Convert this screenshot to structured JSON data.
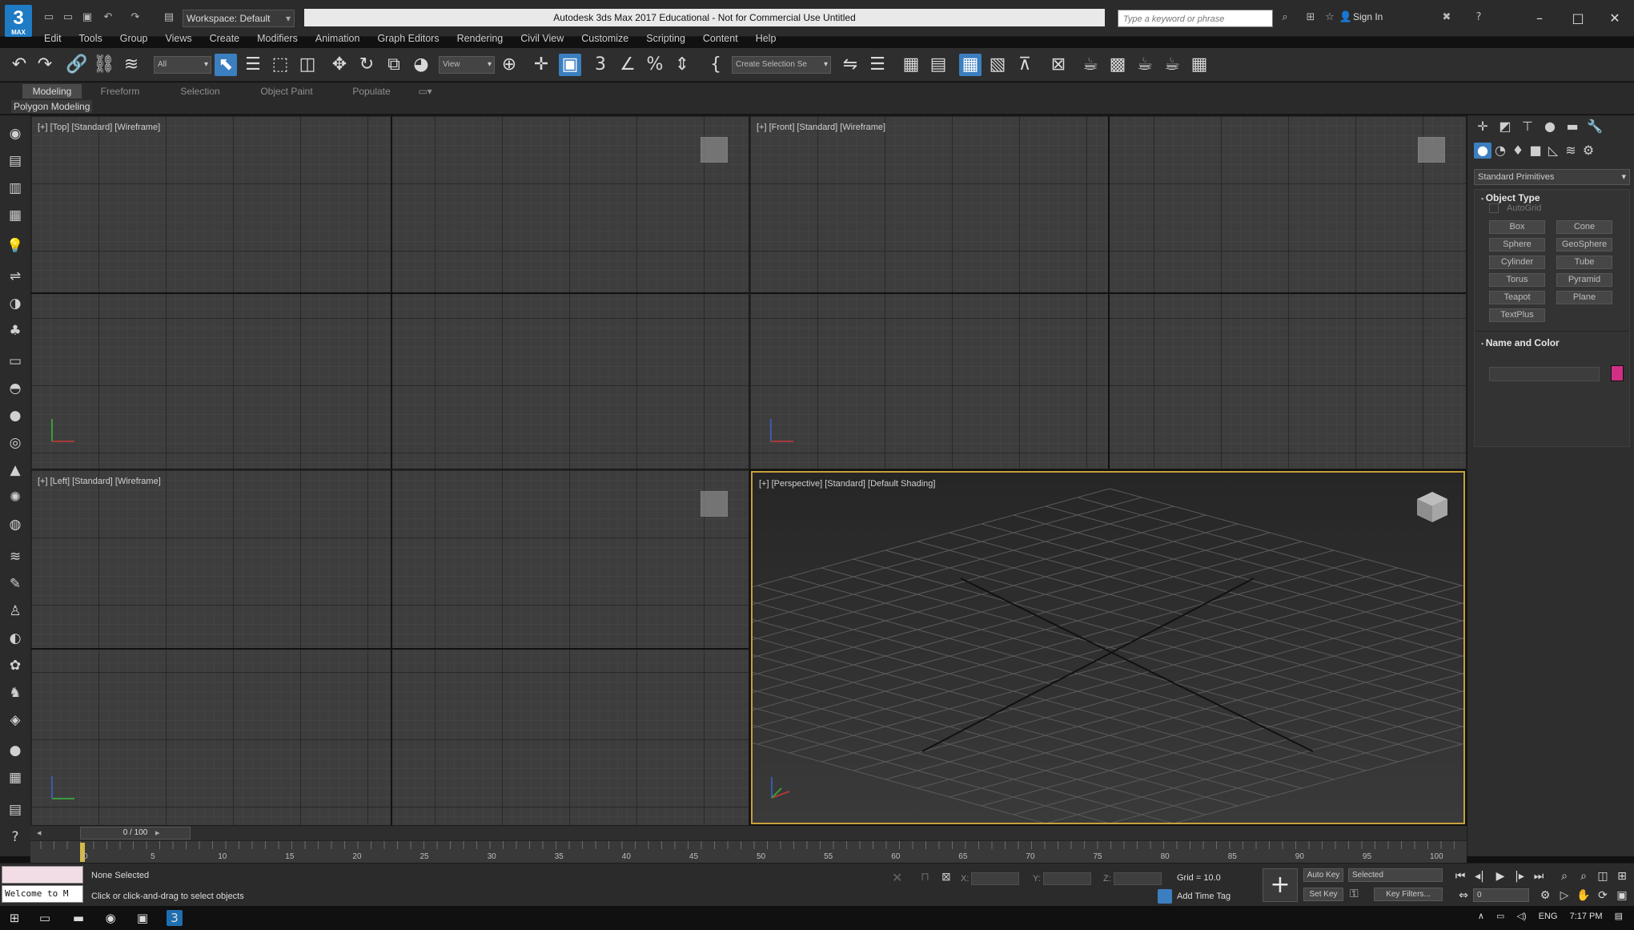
{
  "titlebar": {
    "logo": "3",
    "logo_sub": "MAX",
    "workspace": "Workspace: Default",
    "title": "Autodesk 3ds Max 2017 Educational - Not for Commercial Use    Untitled",
    "search_placeholder": "Type a keyword or phrase",
    "sign_in": "Sign In",
    "quick_access_icons": [
      "new-icon",
      "open-icon",
      "save-icon",
      "undo-icon",
      "redo-icon",
      "project-icon"
    ],
    "window_controls": {
      "minimize": "–",
      "maximize": "□",
      "close": "✕"
    }
  },
  "menubar": {
    "items": [
      "Edit",
      "Tools",
      "Group",
      "Views",
      "Create",
      "Modifiers",
      "Animation",
      "Graph Editors",
      "Rendering",
      "Civil View",
      "Customize",
      "Scripting",
      "Content",
      "Help"
    ]
  },
  "toolbar": {
    "selection_filter": "All",
    "reference_coord": "View",
    "named_selection": "Create Selection Se"
  },
  "ribbon": {
    "tabs": [
      "Modeling",
      "Freeform",
      "Selection",
      "Object Paint",
      "Populate"
    ],
    "active_tab": "Modeling",
    "panel": "Polygon Modeling"
  },
  "viewports": {
    "top": "[+] [Top] [Standard] [Wireframe]",
    "front": "[+] [Front] [Standard] [Wireframe]",
    "left": "[+] [Left] [Standard] [Wireframe]",
    "perspective": "[+] [Perspective] [Standard] [Default Shading]"
  },
  "command_panel": {
    "primitive_type": "Standard Primitives",
    "object_type": {
      "title": "Object Type",
      "autogrid": "AutoGrid",
      "buttons": [
        "Box",
        "Cone",
        "Sphere",
        "GeoSphere",
        "Cylinder",
        "Tube",
        "Torus",
        "Pyramid",
        "Teapot",
        "Plane",
        "TextPlus"
      ]
    },
    "name_and_color": {
      "title": "Name and Color",
      "color": "#d12f86"
    }
  },
  "timeline": {
    "slider": "0 / 100",
    "ticks": [
      "0",
      "5",
      "10",
      "15",
      "20",
      "25",
      "30",
      "35",
      "40",
      "45",
      "50",
      "55",
      "60",
      "65",
      "70",
      "75",
      "80",
      "85",
      "90",
      "95",
      "100"
    ]
  },
  "status": {
    "maxscript": "Welcome to M",
    "selection": "None Selected",
    "prompt": "Click or click-and-drag to select objects",
    "x_label": "X:",
    "y_label": "Y:",
    "z_label": "Z:",
    "grid": "Grid = 10.0",
    "add_time_tag": "Add Time Tag",
    "auto_key": "Auto Key",
    "set_key": "Set Key",
    "key_mode": "Selected",
    "key_filters": "Key Filters...",
    "current_frame": "0"
  },
  "taskbar": {
    "lang": "ENG",
    "time": "7:17 PM"
  },
  "colors": {
    "accent": "#3b7fc0",
    "active_viewport_border": "#c8a13c",
    "viewport_bg": "#3d3d3d"
  }
}
